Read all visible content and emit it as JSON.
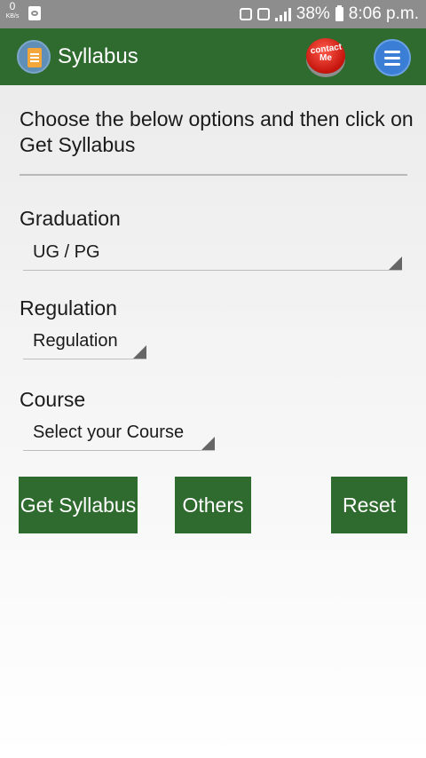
{
  "status_bar": {
    "kbs_value": "0",
    "kbs_unit": "KB/s",
    "battery": "38%",
    "time": "8:06 p.m."
  },
  "app_bar": {
    "title": "Syllabus",
    "logo_icon": "syllabus-document-icon",
    "contact_line1": "contact",
    "contact_line2": "Me",
    "menu_icon": "hamburger-menu-icon"
  },
  "content": {
    "instruction": "Choose the below options and then click on Get Syllabus",
    "graduation_label": "Graduation",
    "graduation_value": "UG / PG",
    "regulation_label": "Regulation",
    "regulation_value": "Regulation",
    "course_label": "Course",
    "course_value": "Select your Course"
  },
  "buttons": {
    "get_syllabus": "Get Syllabus",
    "others": "Others",
    "reset": "Reset"
  },
  "colors": {
    "app_bar": "#2f6a2f",
    "button": "#2f6a2f",
    "status_bar": "#8d8d8d",
    "menu_button": "#3b7ed6",
    "contact_button": "#d6201a"
  }
}
